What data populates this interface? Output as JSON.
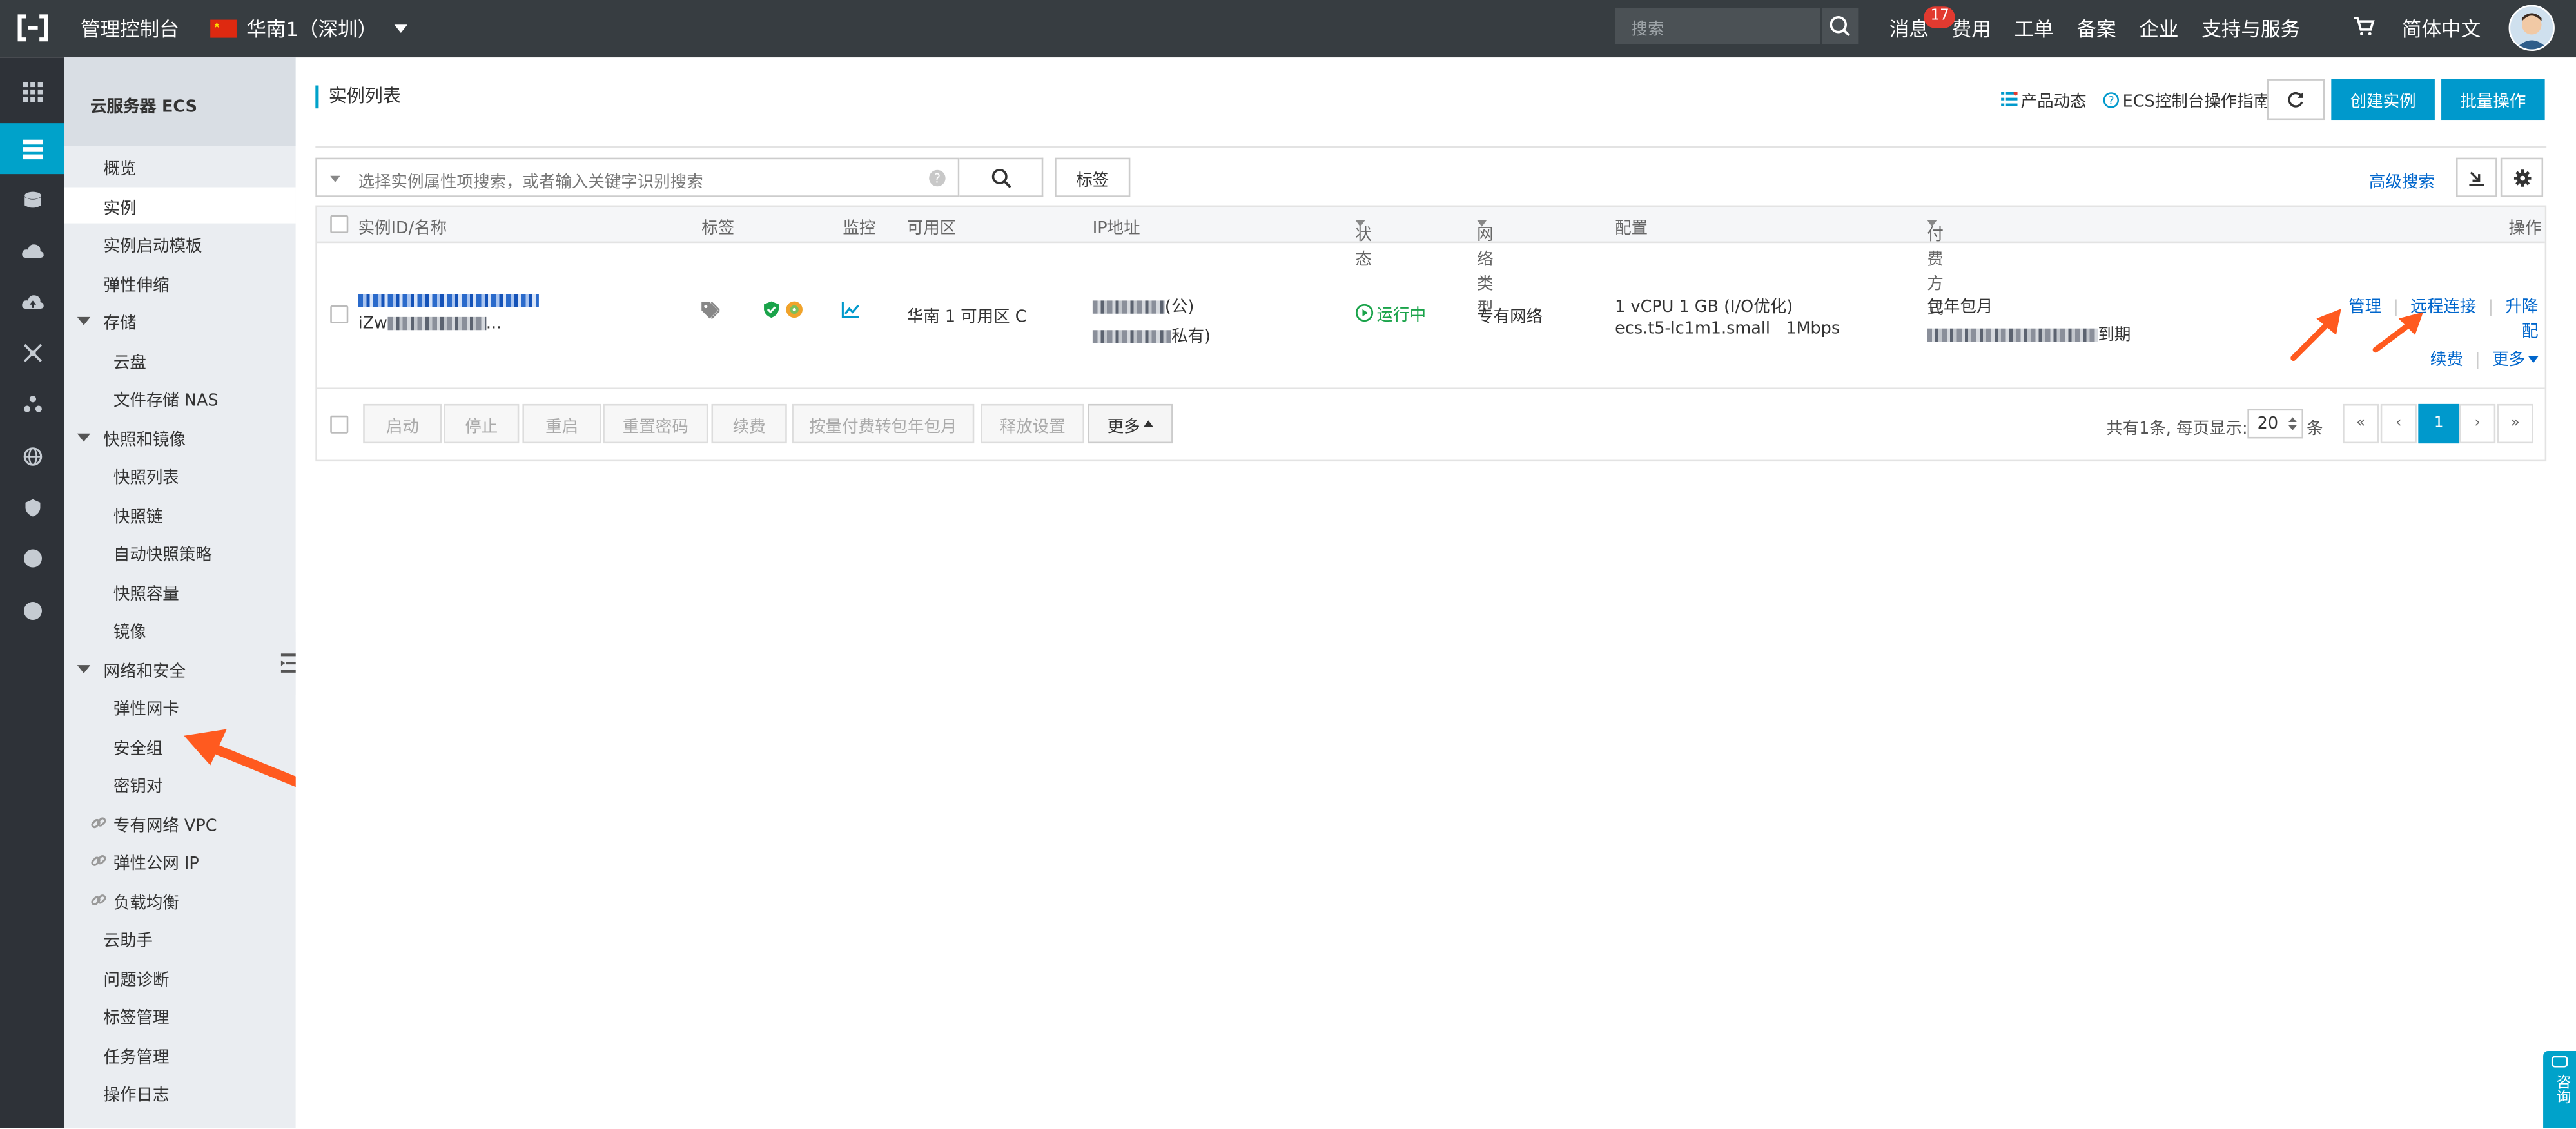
{
  "topbar": {
    "console_label": "管理控制台",
    "region_label": "华南1（深圳）",
    "search_placeholder": "搜索",
    "message_label": "消息",
    "message_count": "17",
    "links": [
      "费用",
      "工单",
      "备案",
      "企业",
      "支持与服务"
    ],
    "language": "简体中文"
  },
  "sidebar": {
    "title": "云服务器 ECS",
    "items": [
      {
        "label": "概览"
      },
      {
        "label": "实例"
      },
      {
        "label": "实例启动模板"
      },
      {
        "label": "弹性伸缩"
      },
      {
        "label": "存储"
      },
      {
        "label": "云盘"
      },
      {
        "label": "文件存储 NAS"
      },
      {
        "label": "快照和镜像"
      },
      {
        "label": "快照列表"
      },
      {
        "label": "快照链"
      },
      {
        "label": "自动快照策略"
      },
      {
        "label": "快照容量"
      },
      {
        "label": "镜像"
      },
      {
        "label": "网络和安全"
      },
      {
        "label": "弹性网卡"
      },
      {
        "label": "安全组"
      },
      {
        "label": "密钥对"
      },
      {
        "label": "专有网络 VPC"
      },
      {
        "label": "弹性公网 IP"
      },
      {
        "label": "负载均衡"
      },
      {
        "label": "云助手"
      },
      {
        "label": "问题诊断"
      },
      {
        "label": "标签管理"
      },
      {
        "label": "任务管理"
      },
      {
        "label": "操作日志"
      }
    ]
  },
  "main": {
    "page_title": "实例列表",
    "product_news": "产品动态",
    "guide": "ECS控制台操作指南",
    "create_instance": "创建实例",
    "batch_ops": "批量操作",
    "filter_placeholder": "选择实例属性项搜索，或者输入关键字识别搜索",
    "tag_button": "标签",
    "advanced_search": "高级搜索",
    "columns": [
      "实例ID/名称",
      "标签",
      "监控",
      "可用区",
      "IP地址",
      "状态",
      "网络类型",
      "配置",
      "付费方式",
      "操作"
    ],
    "row": {
      "name_prefix": "iZw",
      "name_suffix": "...",
      "zone": "华南 1 可用区 C",
      "ip_public_suffix": "(公)",
      "ip_private_suffix": "私有)",
      "status": "运行中",
      "network": "专有网络",
      "config_line1": "1 vCPU 1 GB (I/O优化)",
      "config_line2": "ecs.t5-lc1m1.small   1Mbps",
      "billing_line1": "包年包月",
      "billing_suffix": "到期",
      "actions": {
        "manage": "管理",
        "remote": "远程连接",
        "upgrade": "升降配",
        "renew": "续费",
        "more": "更多"
      }
    },
    "footer_buttons": [
      "启动",
      "停止",
      "重启",
      "重置密码",
      "续费",
      "按量付费转包年包月",
      "释放设置"
    ],
    "footer_more": "更多",
    "pagination": {
      "summary": "共有1条, 每页显示:",
      "page_size": "20",
      "unit": "条",
      "first": "«",
      "prev": "‹",
      "current": "1",
      "next": "›",
      "last": "»"
    }
  },
  "consult_label": "咨询",
  "colors": {
    "accent": "#00a2ca",
    "primary_button": "#0099cc",
    "running": "#1aa34a",
    "arrow": "#ff5a1f"
  }
}
